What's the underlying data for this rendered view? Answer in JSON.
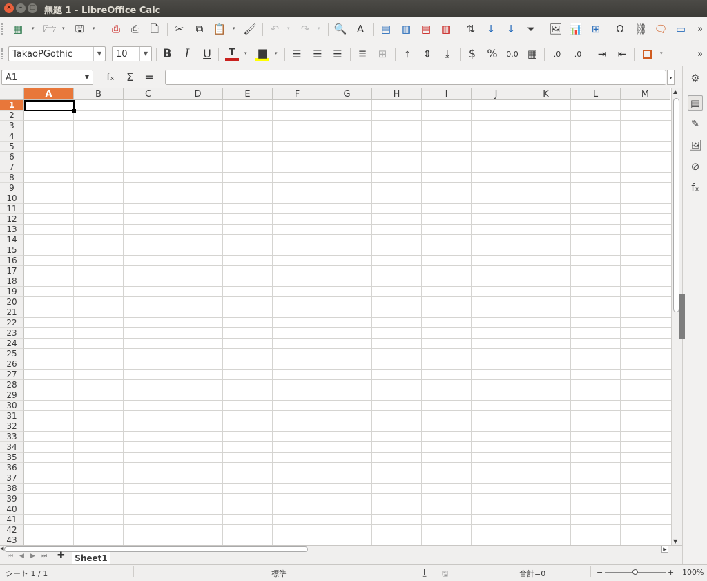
{
  "window": {
    "title": "無題 1 - LibreOffice Calc"
  },
  "toolbar_font": {
    "font_name": "TakaoPGothic",
    "font_size": "10"
  },
  "namebox": {
    "value": "A1"
  },
  "formula": {
    "fx": "fₓ",
    "sum": "Σ",
    "eq": "=",
    "value": ""
  },
  "columns": [
    "A",
    "B",
    "C",
    "D",
    "E",
    "F",
    "G",
    "H",
    "I",
    "J",
    "K",
    "L",
    "M"
  ],
  "rows": [
    "1",
    "2",
    "3",
    "4",
    "5",
    "6",
    "7",
    "8",
    "9",
    "10",
    "11",
    "12",
    "13",
    "14",
    "15",
    "16",
    "17",
    "18",
    "19",
    "20",
    "21",
    "22",
    "23",
    "24",
    "25",
    "26",
    "27",
    "28",
    "29",
    "30",
    "31",
    "32",
    "33",
    "34",
    "35",
    "36",
    "37",
    "38",
    "39",
    "40",
    "41",
    "42",
    "43"
  ],
  "active_cell": {
    "col": "A",
    "row": "1"
  },
  "sheet_tab": {
    "name": "Sheet1"
  },
  "status": {
    "sheet": "シート 1 / 1",
    "style": "標準",
    "sum": "合計=0",
    "zoom": "100%",
    "zoom_minus": "−",
    "zoom_plus": "+"
  },
  "colors": {
    "accent": "#e8773a",
    "font_color": "#c9211e",
    "highlight": "#ffff00",
    "border_icon": "#d05c20"
  }
}
